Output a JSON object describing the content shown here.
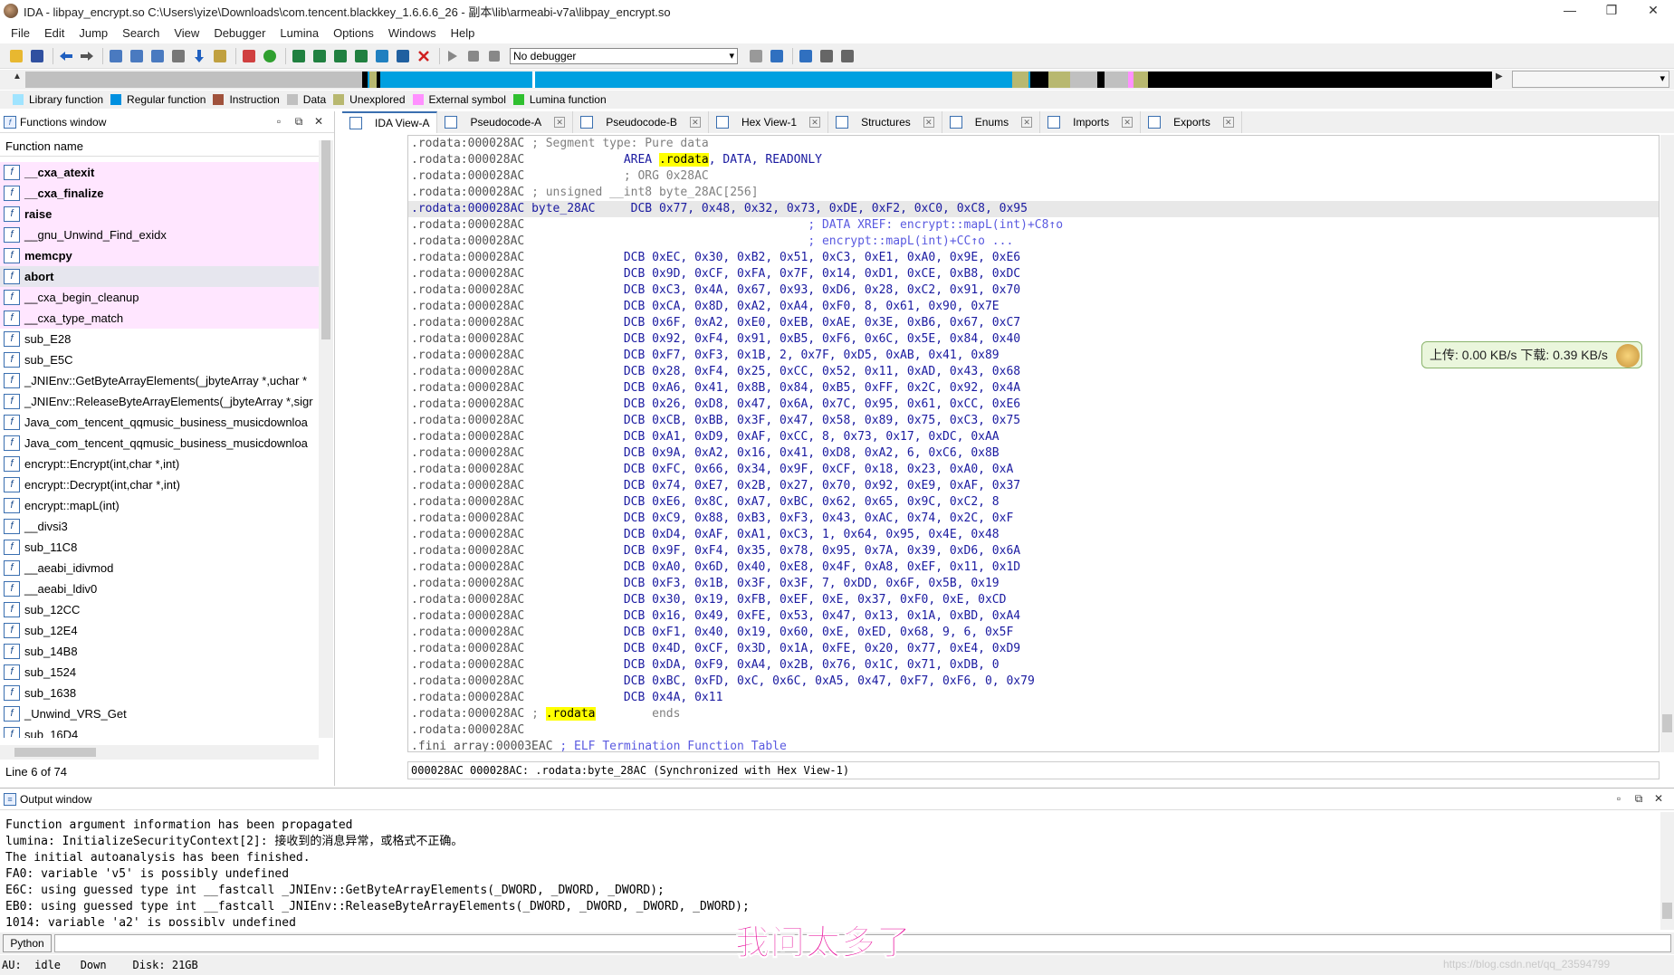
{
  "window": {
    "title": "IDA - libpay_encrypt.so C:\\Users\\yize\\Downloads\\com.tencent.blackkey_1.6.6.6_26 - 副本\\lib\\armeabi-v7a\\libpay_encrypt.so",
    "controls": [
      "—",
      "❐",
      "✕"
    ]
  },
  "menu": [
    "File",
    "Edit",
    "Jump",
    "Search",
    "View",
    "Debugger",
    "Lumina",
    "Options",
    "Windows",
    "Help"
  ],
  "toolbar": {
    "debugger_select": "No debugger"
  },
  "legend": [
    {
      "label": "Library function",
      "color": "#a0e4ff"
    },
    {
      "label": "Regular function",
      "color": "#0090e0"
    },
    {
      "label": "Instruction",
      "color": "#a0523c"
    },
    {
      "label": "Data",
      "color": "#c0c0c0"
    },
    {
      "label": "Unexplored",
      "color": "#b8b870"
    },
    {
      "label": "External symbol",
      "color": "#ff90ff"
    },
    {
      "label": "Lumina function",
      "color": "#30c030"
    }
  ],
  "functions_window": {
    "title": "Functions window",
    "column": "Function name",
    "items": [
      {
        "name": "__cxa_atexit",
        "lib": true,
        "bold": true
      },
      {
        "name": "__cxa_finalize",
        "lib": true,
        "bold": true
      },
      {
        "name": "raise",
        "lib": true,
        "bold": true
      },
      {
        "name": "__gnu_Unwind_Find_exidx",
        "lib": true,
        "bold": false
      },
      {
        "name": "memcpy",
        "lib": true,
        "bold": true
      },
      {
        "name": "abort",
        "lib": true,
        "bold": true,
        "selected": true
      },
      {
        "name": "__cxa_begin_cleanup",
        "lib": true,
        "bold": false
      },
      {
        "name": "__cxa_type_match",
        "lib": true,
        "bold": false
      },
      {
        "name": "sub_E28"
      },
      {
        "name": "sub_E5C"
      },
      {
        "name": "_JNIEnv::GetByteArrayElements(_jbyteArray *,uchar *"
      },
      {
        "name": "_JNIEnv::ReleaseByteArrayElements(_jbyteArray *,sigr"
      },
      {
        "name": "Java_com_tencent_qqmusic_business_musicdownloa"
      },
      {
        "name": "Java_com_tencent_qqmusic_business_musicdownloa"
      },
      {
        "name": "encrypt::Encrypt(int,char *,int)"
      },
      {
        "name": "encrypt::Decrypt(int,char *,int)"
      },
      {
        "name": "encrypt::mapL(int)"
      },
      {
        "name": "__divsi3"
      },
      {
        "name": "sub_11C8"
      },
      {
        "name": "__aeabi_idivmod"
      },
      {
        "name": "__aeabi_ldiv0"
      },
      {
        "name": "sub_12CC"
      },
      {
        "name": "sub_12E4"
      },
      {
        "name": "sub_14B8"
      },
      {
        "name": "sub_1524"
      },
      {
        "name": "sub_1638"
      },
      {
        "name": "_Unwind_VRS_Get"
      },
      {
        "name": "sub_16D4"
      }
    ],
    "line_info": "Line 6 of 74"
  },
  "tabs": [
    {
      "label": "IDA View-A",
      "active": true
    },
    {
      "label": "Pseudocode-A"
    },
    {
      "label": "Pseudocode-B"
    },
    {
      "label": "Hex View-1"
    },
    {
      "label": "Structures"
    },
    {
      "label": "Enums"
    },
    {
      "label": "Imports"
    },
    {
      "label": "Exports"
    }
  ],
  "disasm": {
    "addr": ".rodata:000028AC",
    "seg_comment": "; Segment type: Pure data",
    "area_kw": "AREA",
    "rodata": ".rodata",
    "area_rest": ", DATA, READONLY",
    "org": "; ORG 0x28AC",
    "decl": "; unsigned __int8 byte_28AC[256]",
    "label": "byte_28AC",
    "dcb": "DCB",
    "xref1": "; DATA XREF: encrypt::mapL(int)+C8↑o",
    "xref2": "; encrypt::mapL(int)+CC↑o ...",
    "ends_prefix": "; ",
    "ends": "ends",
    "fini_addr": ".fini_array:00003EAC",
    "fini_comment": "; ELF Termination Function Table",
    "rows": [
      "0x77, 0x48, 0x32, 0x73, 0xDE, 0xF2, 0xC0, 0xC8, 0x95",
      "0xEC, 0x30, 0xB2, 0x51, 0xC3, 0xE1, 0xA0, 0x9E, 0xE6",
      "0x9D, 0xCF, 0xFA, 0x7F, 0x14, 0xD1, 0xCE, 0xB8, 0xDC",
      "0xC3, 0x4A, 0x67, 0x93, 0xD6, 0x28, 0xC2, 0x91, 0x70",
      "0xCA, 0x8D, 0xA2, 0xA4, 0xF0, 8, 0x61, 0x90, 0x7E",
      "0x6F, 0xA2, 0xE0, 0xEB, 0xAE, 0x3E, 0xB6, 0x67, 0xC7",
      "0x92, 0xF4, 0x91, 0xB5, 0xF6, 0x6C, 0x5E, 0x84, 0x40",
      "0xF7, 0xF3, 0x1B, 2, 0x7F, 0xD5, 0xAB, 0x41, 0x89",
      "0x28, 0xF4, 0x25, 0xCC, 0x52, 0x11, 0xAD, 0x43, 0x68",
      "0xA6, 0x41, 0x8B, 0x84, 0xB5, 0xFF, 0x2C, 0x92, 0x4A",
      "0x26, 0xD8, 0x47, 0x6A, 0x7C, 0x95, 0x61, 0xCC, 0xE6",
      "0xCB, 0xBB, 0x3F, 0x47, 0x58, 0x89, 0x75, 0xC3, 0x75",
      "0xA1, 0xD9, 0xAF, 0xCC, 8, 0x73, 0x17, 0xDC, 0xAA",
      "0x9A, 0xA2, 0x16, 0x41, 0xD8, 0xA2, 6, 0xC6, 0x8B",
      "0xFC, 0x66, 0x34, 0x9F, 0xCF, 0x18, 0x23, 0xA0, 0xA",
      "0x74, 0xE7, 0x2B, 0x27, 0x70, 0x92, 0xE9, 0xAF, 0x37",
      "0xE6, 0x8C, 0xA7, 0xBC, 0x62, 0x65, 0x9C, 0xC2, 8",
      "0xC9, 0x88, 0xB3, 0xF3, 0x43, 0xAC, 0x74, 0x2C, 0xF",
      "0xD4, 0xAF, 0xA1, 0xC3, 1, 0x64, 0x95, 0x4E, 0x48",
      "0x9F, 0xF4, 0x35, 0x78, 0x95, 0x7A, 0x39, 0xD6, 0x6A",
      "0xA0, 0x6D, 0x40, 0xE8, 0x4F, 0xA8, 0xEF, 0x11, 0x1D",
      "0xF3, 0x1B, 0x3F, 0x3F, 7, 0xDD, 0x6F, 0x5B, 0x19",
      "0x30, 0x19, 0xFB, 0xEF, 0xE, 0x37, 0xF0, 0xE, 0xCD",
      "0x16, 0x49, 0xFE, 0x53, 0x47, 0x13, 0x1A, 0xBD, 0xA4",
      "0xF1, 0x40, 0x19, 0x60, 0xE, 0xED, 0x68, 9, 6, 0x5F",
      "0x4D, 0xCF, 0x3D, 0x1A, 0xFE, 0x20, 0x77, 0xE4, 0xD9",
      "0xDA, 0xF9, 0xA4, 0x2B, 0x76, 0x1C, 0x71, 0xDB, 0",
      "0xBC, 0xFD, 0xC, 0x6C, 0xA5, 0x47, 0xF7, 0xF6, 0, 0x79",
      "0x4A, 0x11"
    ],
    "status": "000028AC 000028AC: .rodata:byte_28AC (Synchronized with Hex View-1)"
  },
  "net_widget": {
    "text": "上传: 0.00 KB/s    下载: 0.39 KB/s"
  },
  "output": {
    "title": "Output window",
    "lines": [
      "Function argument information has been propagated",
      "lumina: InitializeSecurityContext[2]: 接收到的消息异常，或格式不正确。",
      "The initial autoanalysis has been finished.",
      "FA0: variable 'v5' is possibly undefined",
      "E6C: using guessed type int __fastcall _JNIEnv::GetByteArrayElements(_DWORD, _DWORD, _DWORD);",
      "EB0: using guessed type int __fastcall _JNIEnv::ReleaseByteArrayElements(_DWORD, _DWORD, _DWORD, _DWORD);",
      "1014: variable 'a2' is possibly undefined"
    ]
  },
  "python_button": "Python",
  "status_bar": "AU:  idle   Down    Disk: 21GB",
  "overlay_caption": "我问太多了",
  "watermark": "https://blog.csdn.net/qq_23594799"
}
